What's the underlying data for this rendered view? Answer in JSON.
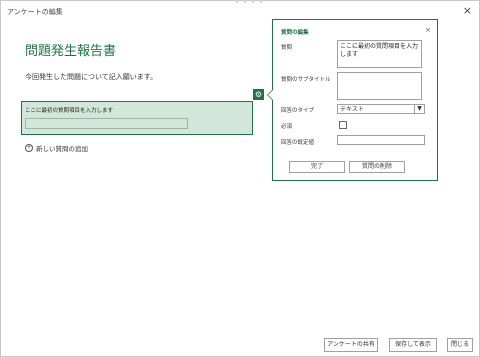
{
  "window": {
    "title": "アンケートの編集",
    "close_symbol": "×"
  },
  "survey": {
    "title": "問題発生報告書",
    "description": "今回発生した問題について記入願います。",
    "question_text": "ここに最初の質問項目を入力します",
    "add_question_label": "新しい質問の追加"
  },
  "edit_panel": {
    "title": "質問の編集",
    "close_symbol": "×",
    "question_label": "質問",
    "question_value": "ここに最初の質問項目を入力します",
    "subtitle_label": "質問のサブタイトル",
    "subtitle_value": "",
    "type_label": "回答のタイプ",
    "type_value": "テキスト",
    "required_label": "必須",
    "default_label": "回答の既定値",
    "default_value": "",
    "done_button": "完了",
    "delete_button": "質問の削除"
  },
  "footer": {
    "share_button": "アンケートの共有",
    "save_view_button": "保存して表示",
    "close_button": "閉じる"
  },
  "colors": {
    "accent": "#217346",
    "question_bg": "#d3e6dc"
  }
}
